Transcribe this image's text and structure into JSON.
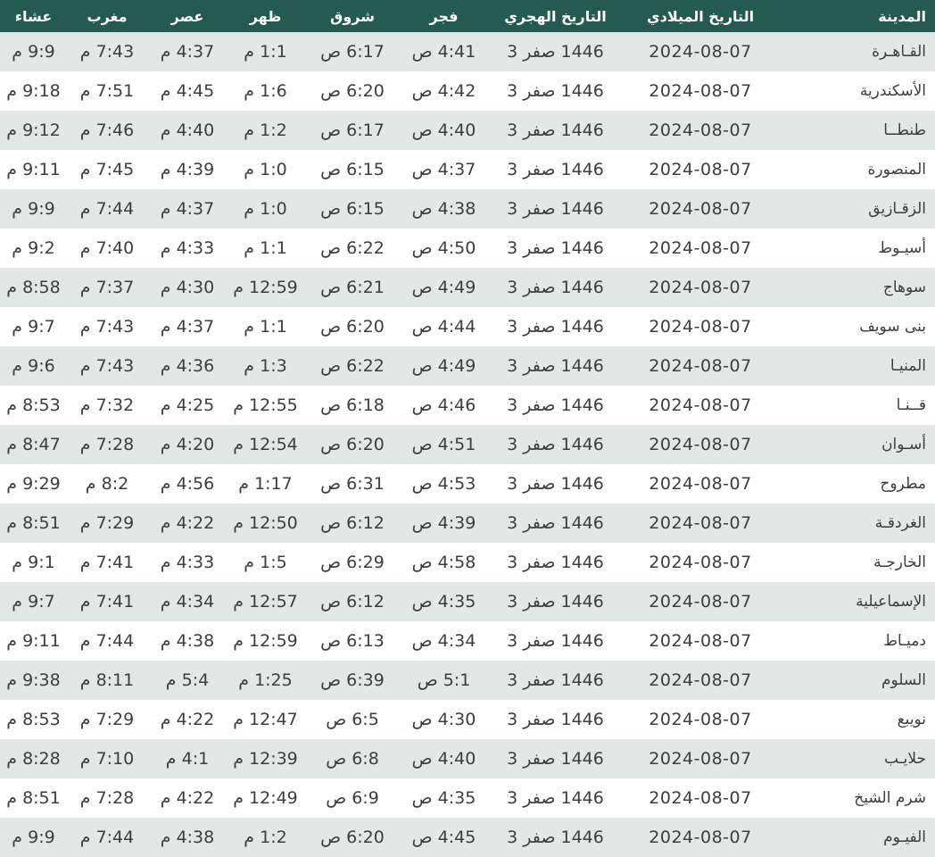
{
  "colors": {
    "header_bg": "#255a4e",
    "header_text": "#ffffff",
    "row_stripe": "#e3e8e6",
    "row_white": "#ffffff",
    "cell_text": "#3d3d3d"
  },
  "table": {
    "columns": [
      {
        "key": "city",
        "label": "المدينة"
      },
      {
        "key": "gregorian",
        "label": "التاريخ الميلادي"
      },
      {
        "key": "hijri",
        "label": "التاريخ الهجري"
      },
      {
        "key": "fajr",
        "label": "فجر"
      },
      {
        "key": "shuruq",
        "label": "شروق"
      },
      {
        "key": "dhuhr",
        "label": "ظهر"
      },
      {
        "key": "asr",
        "label": "عصر"
      },
      {
        "key": "maghrib",
        "label": "مغرب"
      },
      {
        "key": "isha",
        "label": "عشاء"
      }
    ],
    "rows": [
      {
        "city": "القـاهـرة",
        "gregorian": "2024-08-07",
        "hijri": {
          "day": "3",
          "month": "صفر",
          "year": "1446"
        },
        "fajr": "4:41 ص",
        "shuruq": "6:17 ص",
        "dhuhr": "1:1 م",
        "asr": "4:37 م",
        "maghrib": "7:43 م",
        "isha": "9:9 م"
      },
      {
        "city": "الأسكندرية",
        "gregorian": "2024-08-07",
        "hijri": {
          "day": "3",
          "month": "صفر",
          "year": "1446"
        },
        "fajr": "4:42 ص",
        "shuruq": "6:20 ص",
        "dhuhr": "1:6 م",
        "asr": "4:45 م",
        "maghrib": "7:51 م",
        "isha": "9:18 م"
      },
      {
        "city": "طنطــا",
        "gregorian": "2024-08-07",
        "hijri": {
          "day": "3",
          "month": "صفر",
          "year": "1446"
        },
        "fajr": "4:40 ص",
        "shuruq": "6:17 ص",
        "dhuhr": "1:2 م",
        "asr": "4:40 م",
        "maghrib": "7:46 م",
        "isha": "9:12 م"
      },
      {
        "city": "المنصورة",
        "gregorian": "2024-08-07",
        "hijri": {
          "day": "3",
          "month": "صفر",
          "year": "1446"
        },
        "fajr": "4:37 ص",
        "shuruq": "6:15 ص",
        "dhuhr": "1:0 م",
        "asr": "4:39 م",
        "maghrib": "7:45 م",
        "isha": "9:11 م"
      },
      {
        "city": "الزقـازيق",
        "gregorian": "2024-08-07",
        "hijri": {
          "day": "3",
          "month": "صفر",
          "year": "1446"
        },
        "fajr": "4:38 ص",
        "shuruq": "6:15 ص",
        "dhuhr": "1:0 م",
        "asr": "4:37 م",
        "maghrib": "7:44 م",
        "isha": "9:9 م"
      },
      {
        "city": "أسيـوط",
        "gregorian": "2024-08-07",
        "hijri": {
          "day": "3",
          "month": "صفر",
          "year": "1446"
        },
        "fajr": "4:50 ص",
        "shuruq": "6:22 ص",
        "dhuhr": "1:1 م",
        "asr": "4:33 م",
        "maghrib": "7:40 م",
        "isha": "9:2 م"
      },
      {
        "city": "سوهاج",
        "gregorian": "2024-08-07",
        "hijri": {
          "day": "3",
          "month": "صفر",
          "year": "1446"
        },
        "fajr": "4:49 ص",
        "shuruq": "6:21 ص",
        "dhuhr": "12:59 م",
        "asr": "4:30 م",
        "maghrib": "7:37 م",
        "isha": "8:58 م"
      },
      {
        "city": "بنى سويف",
        "gregorian": "2024-08-07",
        "hijri": {
          "day": "3",
          "month": "صفر",
          "year": "1446"
        },
        "fajr": "4:44 ص",
        "shuruq": "6:20 ص",
        "dhuhr": "1:1 م",
        "asr": "4:37 م",
        "maghrib": "7:43 م",
        "isha": "9:7 م"
      },
      {
        "city": "المنيـا",
        "gregorian": "2024-08-07",
        "hijri": {
          "day": "3",
          "month": "صفر",
          "year": "1446"
        },
        "fajr": "4:49 ص",
        "shuruq": "6:22 ص",
        "dhuhr": "1:3 م",
        "asr": "4:36 م",
        "maghrib": "7:43 م",
        "isha": "9:6 م"
      },
      {
        "city": "قــنـا",
        "gregorian": "2024-08-07",
        "hijri": {
          "day": "3",
          "month": "صفر",
          "year": "1446"
        },
        "fajr": "4:46 ص",
        "shuruq": "6:18 ص",
        "dhuhr": "12:55 م",
        "asr": "4:25 م",
        "maghrib": "7:32 م",
        "isha": "8:53 م"
      },
      {
        "city": "أسـوان",
        "gregorian": "2024-08-07",
        "hijri": {
          "day": "3",
          "month": "صفر",
          "year": "1446"
        },
        "fajr": "4:51 ص",
        "shuruq": "6:20 ص",
        "dhuhr": "12:54 م",
        "asr": "4:20 م",
        "maghrib": "7:28 م",
        "isha": "8:47 م"
      },
      {
        "city": "مطروح",
        "gregorian": "2024-08-07",
        "hijri": {
          "day": "3",
          "month": "صفر",
          "year": "1446"
        },
        "fajr": "4:53 ص",
        "shuruq": "6:31 ص",
        "dhuhr": "1:17 م",
        "asr": "4:56 م",
        "maghrib": "8:2 م",
        "isha": "9:29 م"
      },
      {
        "city": "الغردقـة",
        "gregorian": "2024-08-07",
        "hijri": {
          "day": "3",
          "month": "صفر",
          "year": "1446"
        },
        "fajr": "4:39 ص",
        "shuruq": "6:12 ص",
        "dhuhr": "12:50 م",
        "asr": "4:22 م",
        "maghrib": "7:29 م",
        "isha": "8:51 م"
      },
      {
        "city": "الخارجـة",
        "gregorian": "2024-08-07",
        "hijri": {
          "day": "3",
          "month": "صفر",
          "year": "1446"
        },
        "fajr": "4:58 ص",
        "shuruq": "6:29 ص",
        "dhuhr": "1:5 م",
        "asr": "4:33 م",
        "maghrib": "7:41 م",
        "isha": "9:1 م"
      },
      {
        "city": "الإسماعيلية",
        "gregorian": "2024-08-07",
        "hijri": {
          "day": "3",
          "month": "صفر",
          "year": "1446"
        },
        "fajr": "4:35 ص",
        "shuruq": "6:12 ص",
        "dhuhr": "12:57 م",
        "asr": "4:34 م",
        "maghrib": "7:41 م",
        "isha": "9:7 م"
      },
      {
        "city": "دميـاط",
        "gregorian": "2024-08-07",
        "hijri": {
          "day": "3",
          "month": "صفر",
          "year": "1446"
        },
        "fajr": "4:34 ص",
        "shuruq": "6:13 ص",
        "dhuhr": "12:59 م",
        "asr": "4:38 م",
        "maghrib": "7:44 م",
        "isha": "9:11 م"
      },
      {
        "city": "السلوم",
        "gregorian": "2024-08-07",
        "hijri": {
          "day": "3",
          "month": "صفر",
          "year": "1446"
        },
        "fajr": "5:1 ص",
        "shuruq": "6:39 ص",
        "dhuhr": "1:25 م",
        "asr": "5:4 م",
        "maghrib": "8:11 م",
        "isha": "9:38 م"
      },
      {
        "city": "نويبع",
        "gregorian": "2024-08-07",
        "hijri": {
          "day": "3",
          "month": "صفر",
          "year": "1446"
        },
        "fajr": "4:30 ص",
        "shuruq": "6:5 ص",
        "dhuhr": "12:47 م",
        "asr": "4:22 م",
        "maghrib": "7:29 م",
        "isha": "8:53 م"
      },
      {
        "city": "حلايـب",
        "gregorian": "2024-08-07",
        "hijri": {
          "day": "3",
          "month": "صفر",
          "year": "1446"
        },
        "fajr": "4:40 ص",
        "shuruq": "6:8 ص",
        "dhuhr": "12:39 م",
        "asr": "4:1 م",
        "maghrib": "7:10 م",
        "isha": "8:28 م"
      },
      {
        "city": "شرم الشيخ",
        "gregorian": "2024-08-07",
        "hijri": {
          "day": "3",
          "month": "صفر",
          "year": "1446"
        },
        "fajr": "4:35 ص",
        "shuruq": "6:9 ص",
        "dhuhr": "12:49 م",
        "asr": "4:22 م",
        "maghrib": "7:28 م",
        "isha": "8:51 م"
      },
      {
        "city": "الفيـوم",
        "gregorian": "2024-08-07",
        "hijri": {
          "day": "3",
          "month": "صفر",
          "year": "1446"
        },
        "fajr": "4:45 ص",
        "shuruq": "6:20 ص",
        "dhuhr": "1:2 م",
        "asr": "4:38 م",
        "maghrib": "7:44 م",
        "isha": "9:9 م"
      }
    ]
  }
}
